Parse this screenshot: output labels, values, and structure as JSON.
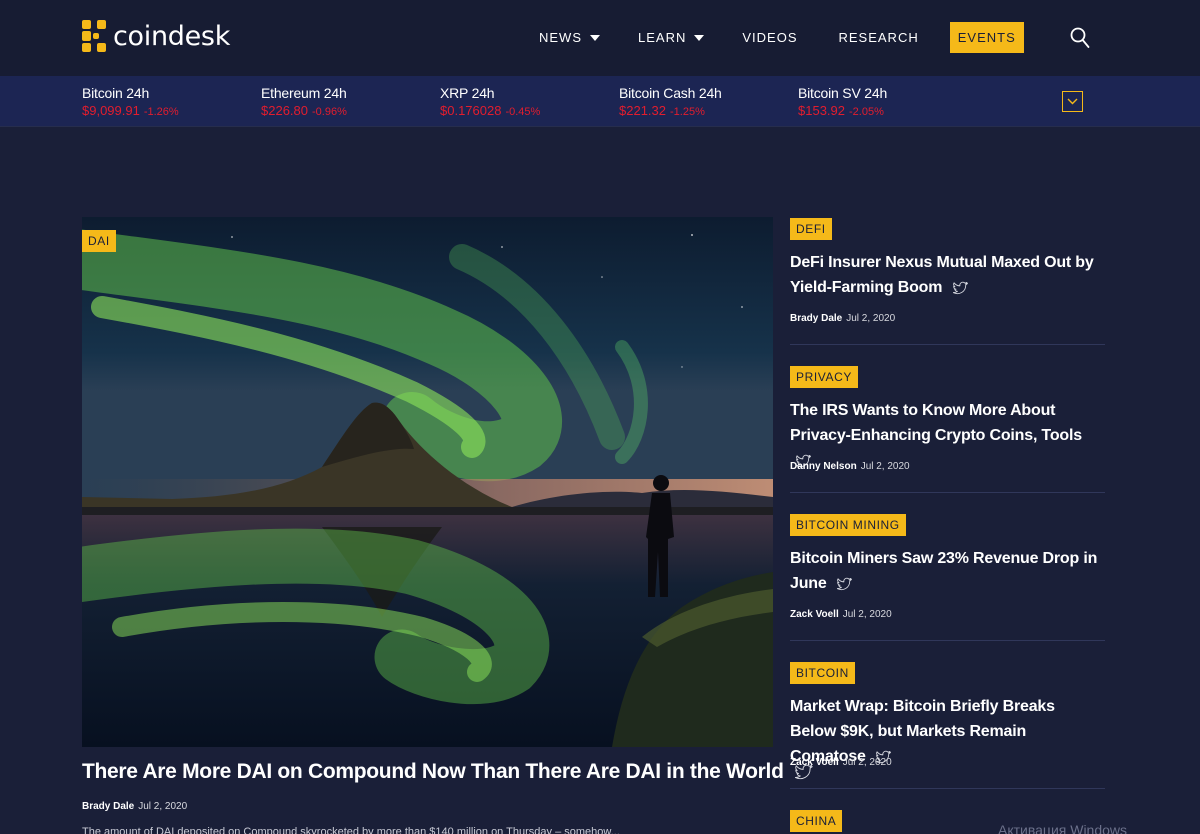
{
  "brand": {
    "name": "coindesk"
  },
  "nav": [
    {
      "label": "NEWS",
      "dropdown": true
    },
    {
      "label": "LEARN",
      "dropdown": true
    },
    {
      "label": "VIDEOS",
      "dropdown": false
    },
    {
      "label": "RESEARCH",
      "dropdown": false
    },
    {
      "label": "EVENTS",
      "dropdown": false,
      "highlighted": true
    }
  ],
  "ticker": [
    {
      "name": "Bitcoin 24h",
      "price": "$9,099.91",
      "change": "-1.26%"
    },
    {
      "name": "Ethereum 24h",
      "price": "$226.80",
      "change": "-0.96%"
    },
    {
      "name": "XRP 24h",
      "price": "$0.176028",
      "change": "-0.45%"
    },
    {
      "name": "Bitcoin Cash 24h",
      "price": "$221.32",
      "change": "-1.25%"
    },
    {
      "name": "Bitcoin SV 24h",
      "price": "$153.92",
      "change": "-2.05%"
    }
  ],
  "hero": {
    "tag": "DAI",
    "title": "There Are More DAI on Compound Now Than There Are DAI in the World",
    "author": "Brady Dale",
    "date": "Jul 2, 2020",
    "excerpt": "The amount of DAI deposited on Compound skyrocketed by more than $140 million on Thursday – somehow..."
  },
  "sidebar": [
    {
      "tag": "DEFI",
      "title": "DeFi Insurer Nexus Mutual Maxed Out by Yield-Farming Boom",
      "author": "Brady Dale",
      "date": "Jul 2, 2020"
    },
    {
      "tag": "PRIVACY",
      "title": "The IRS Wants to Know More About Privacy-Enhancing Crypto Coins, Tools",
      "author": "Danny Nelson",
      "date": "Jul 2, 2020"
    },
    {
      "tag": "BITCOIN MINING",
      "title": "Bitcoin Miners Saw 23% Revenue Drop in June",
      "author": "Zack Voell",
      "date": "Jul 2, 2020"
    },
    {
      "tag": "BITCOIN",
      "title": "Market Wrap: Bitcoin Briefly Breaks Below $9K, but Markets Remain Comatose",
      "author": "Zack Voell",
      "date": "Jul 2, 2020"
    },
    {
      "tag": "CHINA"
    }
  ],
  "watermark": "Активация Windows",
  "colors": {
    "accent": "#f5b919",
    "background": "#1a1f38",
    "header": "#171c33",
    "ticker": "#1c2553",
    "negative": "#e21d2e"
  },
  "icons": {
    "search": "search-icon",
    "twitter": "twitter-icon",
    "ticker_toggle": "chevron-down-icon",
    "logo": "coindesk-logo-icon"
  }
}
